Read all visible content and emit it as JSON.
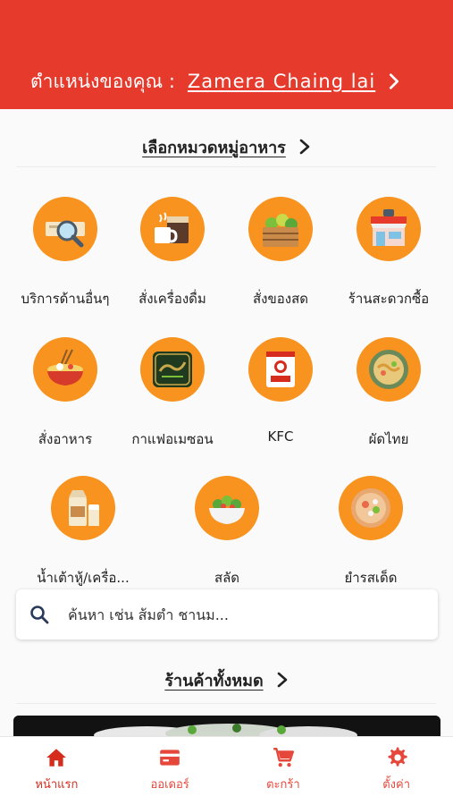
{
  "header": {
    "location_label": "ตำแหน่งของคุณ :",
    "location_value": "Zamera Chaing lai"
  },
  "categories_section": {
    "title": "เลือกหมวดหมู่อาหาร"
  },
  "categories": [
    {
      "label": "บริการด้านอื่นๆ",
      "icon": "search-doc-icon"
    },
    {
      "label": "สั่งเครื่องดื่ม",
      "icon": "drink-cup-icon"
    },
    {
      "label": "สั่งของสด",
      "icon": "vegetable-crate-icon"
    },
    {
      "label": "ร้านสะดวกซื้อ",
      "icon": "store-front-icon"
    },
    {
      "label": "สั่งอาหาร",
      "icon": "noodle-bowl-icon"
    },
    {
      "label": "กาแฟอเมซอน",
      "icon": "amazon-coffee-logo-icon"
    },
    {
      "label": "KFC",
      "icon": "kfc-logo-icon"
    },
    {
      "label": "ผัดไทย",
      "icon": "pad-thai-plate-icon"
    },
    {
      "label": "น้ำเต้าหู้/เครื่อ...",
      "icon": "soy-milk-icon"
    },
    {
      "label": "สลัด",
      "icon": "salad-bowl-icon"
    },
    {
      "label": "ยำรสเด็ด",
      "icon": "spicy-salad-plate-icon"
    }
  ],
  "search": {
    "placeholder": "ค้นหา เช่น ส้มตำ ชานม..."
  },
  "stores_section": {
    "title": "ร้านค้าทั้งหมด"
  },
  "tabbar": {
    "tabs": [
      {
        "label": "หน้าแรก",
        "icon": "home-icon",
        "active": true
      },
      {
        "label": "ออเดอร์",
        "icon": "receipt-icon",
        "active": false
      },
      {
        "label": "ตะกร้า",
        "icon": "cart-icon",
        "active": false
      },
      {
        "label": "ตั้งค่า",
        "icon": "gear-icon",
        "active": false
      }
    ]
  },
  "colors": {
    "header_red": "#e53a2c",
    "category_orange": "#f7931e",
    "tab_red": "#e5483a"
  }
}
